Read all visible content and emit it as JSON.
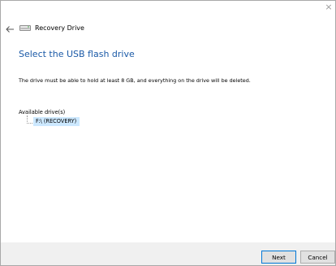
{
  "window": {
    "title": "Recovery Drive",
    "close_glyph": "×",
    "back_icon": "back-arrow-icon",
    "title_icon": "usb-drive-icon"
  },
  "main": {
    "heading": "Select the USB flash drive",
    "description": "The drive must be able to hold at least 8 GB, and everything on the drive will be deleted.",
    "drives_label": "Available drive(s)",
    "drives": [
      {
        "label": "F:\\ (RECOVERY)",
        "selected": true
      }
    ]
  },
  "footer": {
    "next_label": "Next",
    "cancel_label": "Cancel"
  },
  "colors": {
    "heading": "#1b5aa7",
    "selection": "#cce8ff",
    "footer_bg": "#f0f0f0",
    "default_button_border": "#0078d7"
  }
}
